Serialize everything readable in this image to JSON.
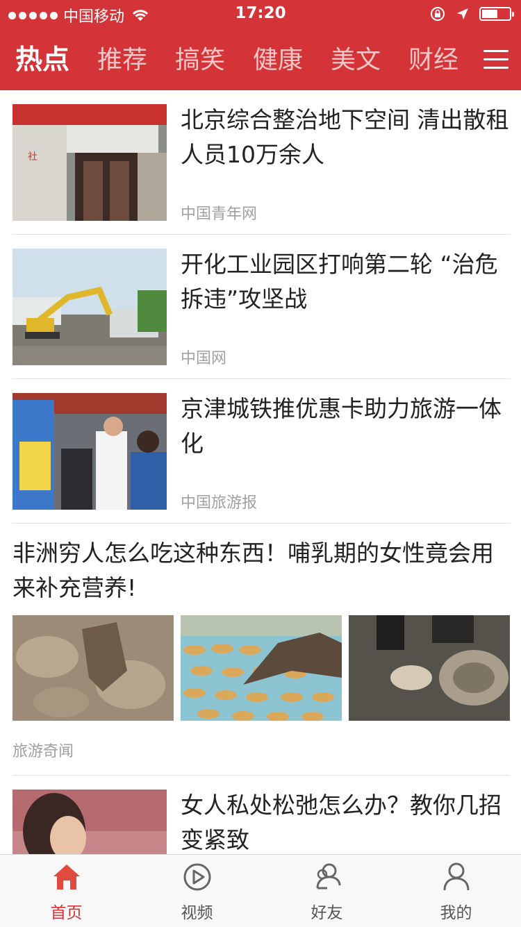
{
  "status_bar": {
    "carrier": "中国移动",
    "time": "17:20"
  },
  "nav": {
    "tabs": [
      {
        "label": "热点",
        "active": true
      },
      {
        "label": "推荐",
        "active": false
      },
      {
        "label": "搞笑",
        "active": false
      },
      {
        "label": "健康",
        "active": false
      },
      {
        "label": "美文",
        "active": false
      },
      {
        "label": "财经",
        "active": false
      }
    ],
    "menu_icon": "menu-icon"
  },
  "feed": {
    "items": [
      {
        "title": "北京综合整治地下空间 清出散租人员10万余人",
        "source": "中国青年网"
      },
      {
        "title": "开化工业园区打响第二轮 “治危拆违”攻坚战",
        "source": "中国网"
      },
      {
        "title": "京津城铁推优惠卡助力旅游一体化",
        "source": "中国旅游报"
      },
      {
        "title": "非洲穷人怎么吃这种东西！哺乳期的女性竟会用来补充营养!",
        "source": "旅游奇闻"
      },
      {
        "title": "女人私处松弛怎么办？教你几招变紧致",
        "source": ""
      }
    ]
  },
  "tabbar": {
    "tabs": [
      {
        "label": "首页",
        "icon": "home-icon",
        "active": true
      },
      {
        "label": "视频",
        "icon": "play-icon",
        "active": false
      },
      {
        "label": "好友",
        "icon": "friends-icon",
        "active": false
      },
      {
        "label": "我的",
        "icon": "user-icon",
        "active": false
      }
    ]
  },
  "colors": {
    "accent": "#d43437",
    "source_text": "#a0a0a0"
  }
}
